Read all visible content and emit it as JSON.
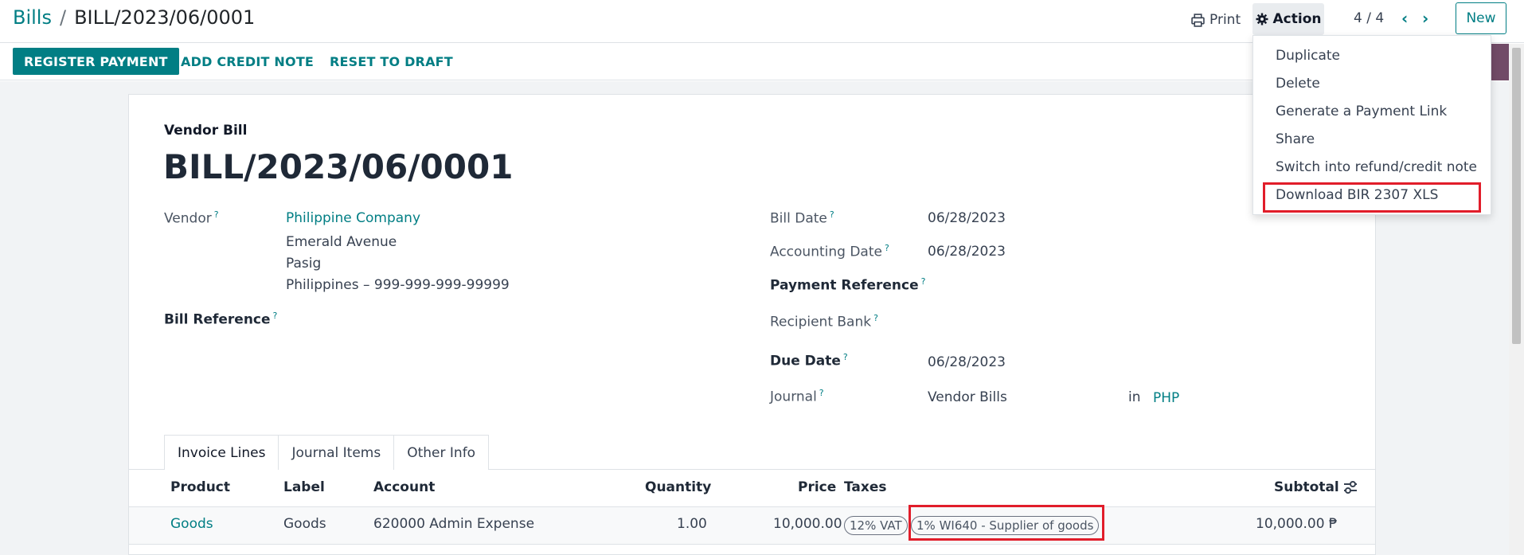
{
  "breadcrumb": {
    "parent": "Bills",
    "separator": "/",
    "current": "BILL/2023/06/0001"
  },
  "toolbar": {
    "print_label": "Print",
    "action_label": "Action",
    "pager": "4 / 4",
    "new_label": "New"
  },
  "status_actions": {
    "register_payment": "REGISTER PAYMENT",
    "add_credit_note": "ADD CREDIT NOTE",
    "reset_to_draft": "RESET TO DRAFT"
  },
  "action_menu": {
    "items": [
      "Duplicate",
      "Delete",
      "Generate a Payment Link",
      "Share",
      "Switch into refund/credit note",
      "Download BIR 2307 XLS"
    ]
  },
  "form": {
    "doc_type": "Vendor Bill",
    "doc_name": "BILL/2023/06/0001",
    "vendor_label": "Vendor",
    "vendor_name": "Philippine Company",
    "vendor_address": [
      "Emerald Avenue",
      "Pasig",
      "Philippines – 999-999-999-99999"
    ],
    "bill_reference_label": "Bill Reference",
    "bill_date_label": "Bill Date",
    "bill_date": "06/28/2023",
    "accounting_date_label": "Accounting Date",
    "accounting_date": "06/28/2023",
    "payment_reference_label": "Payment Reference",
    "recipient_bank_label": "Recipient Bank",
    "due_date_label": "Due Date",
    "due_date": "06/28/2023",
    "journal_label": "Journal",
    "journal": "Vendor Bills",
    "in_label": "in",
    "currency": "PHP",
    "help_mark": "?"
  },
  "tabs": [
    "Invoice Lines",
    "Journal Items",
    "Other Info"
  ],
  "invoice_lines": {
    "headers": {
      "product": "Product",
      "label": "Label",
      "account": "Account",
      "quantity": "Quantity",
      "price": "Price",
      "taxes": "Taxes",
      "subtotal": "Subtotal"
    },
    "rows": [
      {
        "product": "Goods",
        "label": "Goods",
        "account": "620000 Admin Expense",
        "quantity": "1.00",
        "price": "10,000.00",
        "taxes": [
          "12% VAT",
          "1% WI640 - Supplier of goods"
        ],
        "subtotal": "10,000.00 ₱"
      }
    ]
  },
  "colors": {
    "accent": "#017e84",
    "highlight": "#e11d2a",
    "brand": "#714b67"
  },
  "icons": {
    "print": "print-icon",
    "action": "gear-icon",
    "prev": "chevron-left-icon",
    "next": "chevron-right-icon",
    "optional_columns": "sliders-icon"
  }
}
